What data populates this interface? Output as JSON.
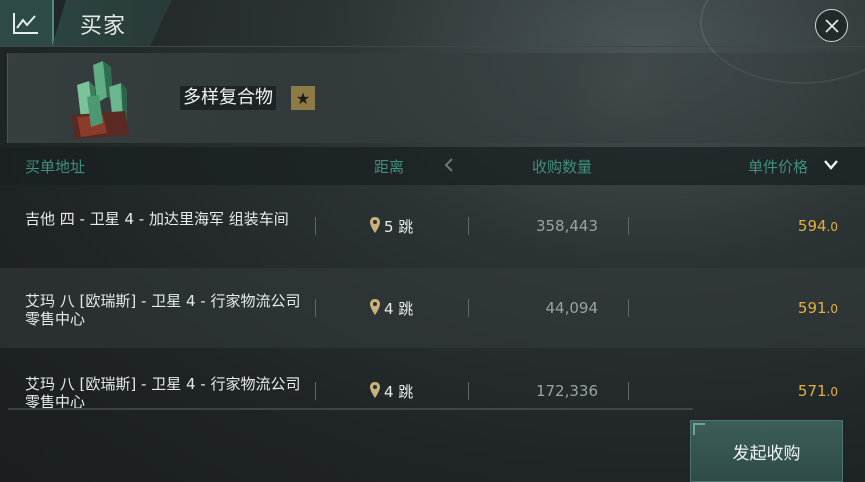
{
  "header": {
    "title": "买家"
  },
  "item": {
    "name": "多样复合物",
    "star": "★"
  },
  "columns": {
    "address": "买单地址",
    "distance": "距离",
    "quantity": "收购数量",
    "price": "单件价格"
  },
  "rows": [
    {
      "address": "吉他 四 - 卫星 4 - 加达里海军 组装车间",
      "jumps": "5 跳",
      "quantity": "358,443",
      "price_int": "594",
      "price_dec": ".0"
    },
    {
      "address": "艾玛 八 [欧瑞斯] - 卫星 4 - 行家物流公司 零售中心",
      "jumps": "4 跳",
      "quantity": "44,094",
      "price_int": "591",
      "price_dec": ".0"
    },
    {
      "address": "艾玛 八 [欧瑞斯] - 卫星 4 - 行家物流公司 零售中心",
      "jumps": "4 跳",
      "quantity": "172,336",
      "price_int": "571",
      "price_dec": ".0"
    }
  ],
  "actions": {
    "place_buy_order": "发起收购"
  },
  "colors": {
    "accent": "#3f8f7b",
    "price": "#e2b13b",
    "header_bg": "#2d4a47"
  }
}
